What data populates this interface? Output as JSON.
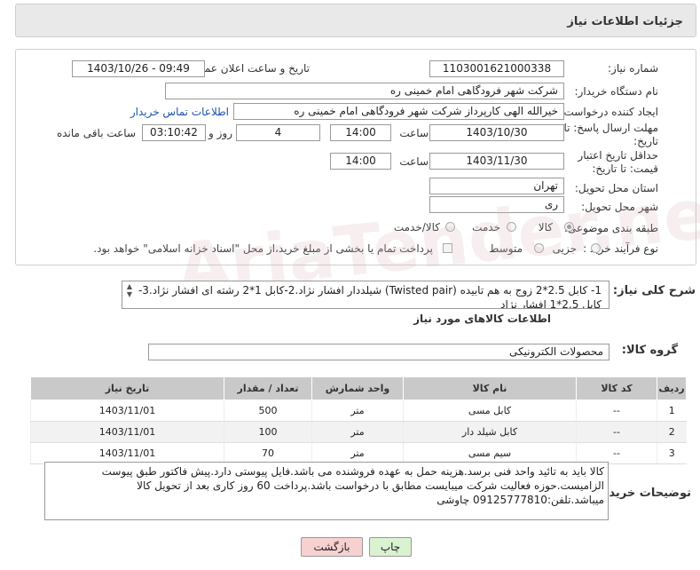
{
  "header": {
    "title": "جزئیات اطلاعات نیاز"
  },
  "form": {
    "need_number_label": "شماره نیاز:",
    "need_number": "1103001621000338",
    "announce_label": "تاریخ و ساعت اعلان عمومی:",
    "announce_value": "1403/10/26 - 09:49",
    "buyer_org_label": "نام دستگاه خریدار:",
    "buyer_org": "شرکت شهر فرودگاهی امام خمینی  ره",
    "requester_label": "ایجاد کننده درخواست:",
    "requester": "خیرالله الهی کارپرداز شرکت شهر فرودگاهی امام خمینی  ره",
    "contact_link": "اطلاعات تماس خریدار",
    "reply_deadline_label": "مهلت ارسال پاسخ: تا تاریخ:",
    "reply_date": "1403/10/30",
    "time_label": "ساعت",
    "reply_time": "14:00",
    "days_value": "4",
    "days_label": "روز و",
    "remaining_time": "03:10:42",
    "remaining_label": "ساعت باقی مانده",
    "price_validity_label": "حداقل تاریخ اعتبار قیمت: تا تاریخ:",
    "validity_date": "1403/11/30",
    "validity_time": "14:00",
    "province_label": "استان محل تحویل:",
    "province": "تهران",
    "city_label": "شهر محل تحویل:",
    "city": "ری",
    "category_label": "طبقه بندی موضوعی:",
    "category_options": [
      "کالا",
      "خدمت",
      "کالا/خدمت"
    ],
    "purchase_type_label": "نوع فرآیند خرید :",
    "purchase_options": [
      "جزیی",
      "متوسط"
    ],
    "payment_note": "پرداخت تمام یا بخشی از مبلغ خرید،از محل \"اسناد خزانه اسلامی\" خواهد بود."
  },
  "description": {
    "label": "شرح کلی نیاز:",
    "text": "1- کابل 2.5*2 زوج به هم تابیده (Twisted pair) شیلددار افشار نژاد.2-کابل 1*2 رشته ای افشار نژاد.3-کابل 2.5*1 افشار نژاد"
  },
  "goods": {
    "section_title": "اطلاعات کالاهای مورد نیاز",
    "group_label": "گروه کالا:",
    "group_value": "محصولات الکترونیکی",
    "columns": [
      "ردیف",
      "کد کالا",
      "نام کالا",
      "واحد شمارش",
      "تعداد / مقدار",
      "تاریخ نیاز"
    ],
    "rows": [
      [
        "1",
        "--",
        "کابل مسی",
        "متر",
        "500",
        "1403/11/01"
      ],
      [
        "2",
        "--",
        "کابل شیلد دار",
        "متر",
        "100",
        "1403/11/01"
      ],
      [
        "3",
        "--",
        "سیم مسی",
        "متر",
        "70",
        "1403/11/01"
      ]
    ]
  },
  "buyer_notes": {
    "label": "توضیحات خریدار:",
    "text": "کالا باید به تائید واحد فنی برسد.هزینه حمل به عهده فروشنده می باشد.فایل پیوستی دارد.پیش فاکتور طبق پیوست الزامیست.حوزه فعالیت شرکت میبایست مطابق با درخواست باشد.پرداخت 60 روز کاری بعد از تحویل کالا میباشد.تلفن:09125777810 چاوشی"
  },
  "buttons": {
    "print": "چاپ",
    "back": "بازگشت"
  },
  "watermark": "AriaTender.neT",
  "colors": {
    "header_bg": "#e9e9e9",
    "table_header": "#c9c9c9",
    "print_btn": "#d9f2d0",
    "back_btn": "#f7d0d0"
  }
}
